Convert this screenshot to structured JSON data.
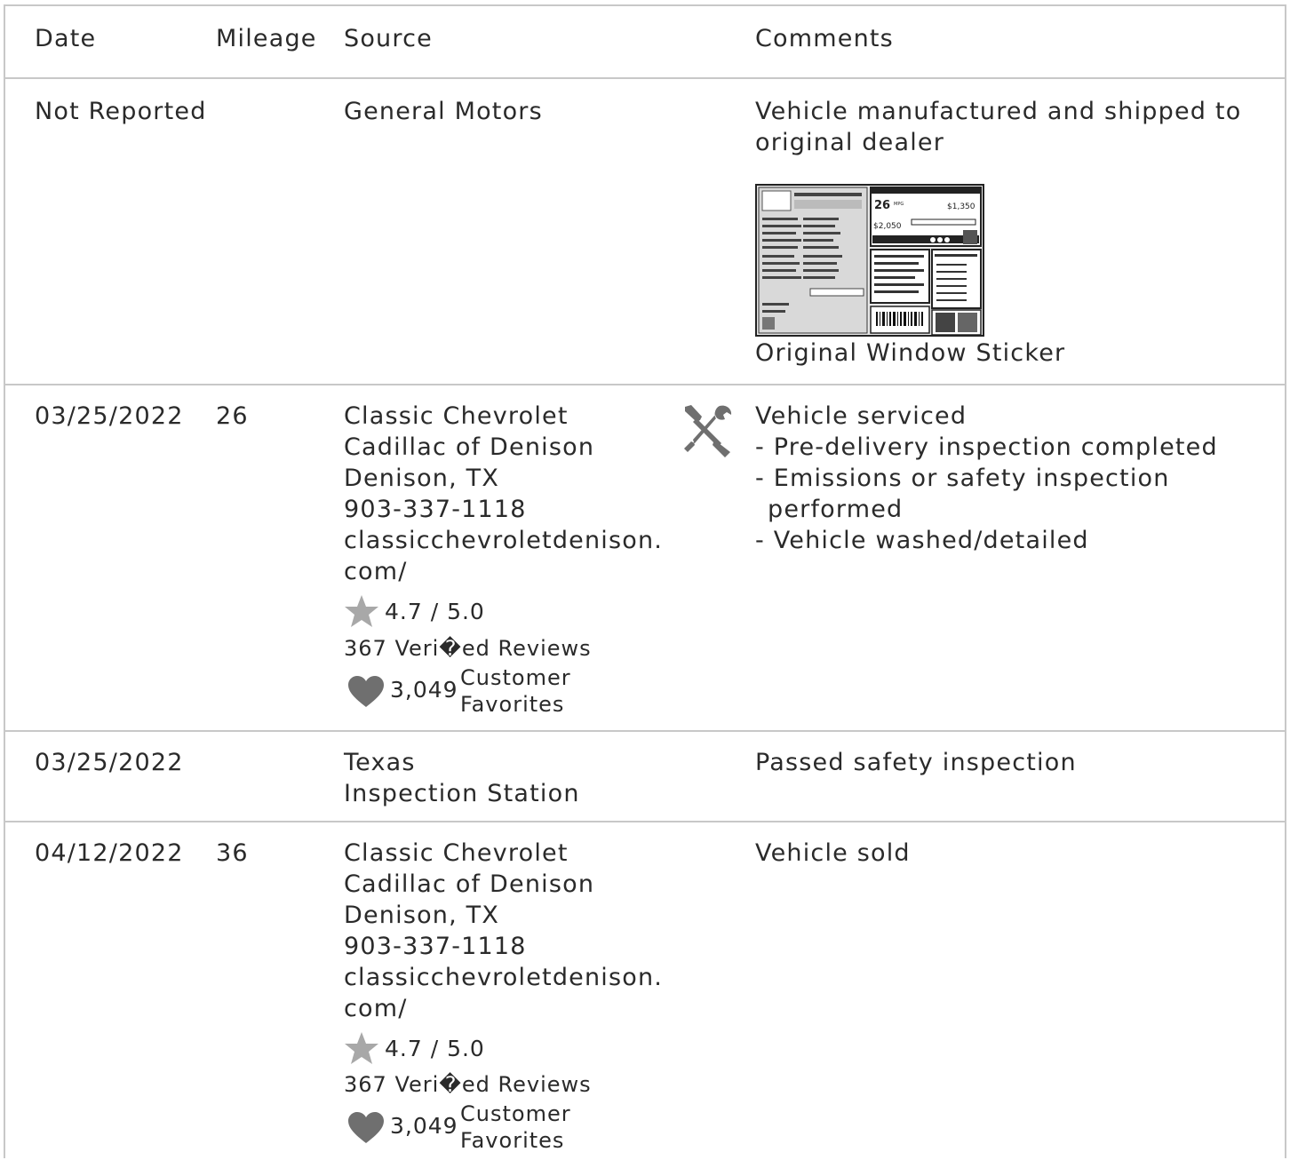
{
  "headers": {
    "date": "Date",
    "mileage": "Mileage",
    "source": "Source",
    "comments": "Comments"
  },
  "rows": [
    {
      "date": "Not Reported",
      "mileage": "",
      "source": [
        "General Motors"
      ],
      "comments": [
        "Vehicle manufactured and shipped to",
        "original dealer"
      ],
      "sticker_caption": "Original Window Sticker",
      "sticker_text": {
        "mpg": "26",
        "mpg_unit": "MPG",
        "cost1": "$1,350",
        "cost2": "$2,050"
      }
    },
    {
      "date": "03/25/2022",
      "mileage": "26",
      "source": [
        "Classic Chevrolet",
        "Cadillac of Denison",
        "Denison, TX",
        "903-337-1118",
        "classicchevroletdenison.",
        "com/"
      ],
      "rating": "4.7 / 5.0",
      "reviews": "367 Veri�ed Reviews",
      "favorites_count": "3,049",
      "favorites_label": [
        "Customer",
        "Favorites"
      ],
      "comments": [
        "Vehicle serviced",
        "- Pre-delivery inspection completed",
        "- Emissions or safety inspection",
        "performed",
        "- Vehicle washed/detailed"
      ],
      "icon": "service-tools-icon"
    },
    {
      "date": "03/25/2022",
      "mileage": "",
      "source": [
        "Texas",
        "Inspection Station"
      ],
      "comments": [
        "Passed safety inspection"
      ]
    },
    {
      "date": "04/12/2022",
      "mileage": "36",
      "source": [
        "Classic Chevrolet",
        "Cadillac of Denison",
        "Denison, TX",
        "903-337-1118",
        "classicchevroletdenison.",
        "com/"
      ],
      "rating": "4.7 / 5.0",
      "reviews": "367 Veri�ed Reviews",
      "favorites_count": "3,049",
      "favorites_label": [
        "Customer",
        "Favorites"
      ],
      "comments": [
        "Vehicle sold"
      ]
    }
  ],
  "colors": {
    "border": "#c8c8c8",
    "icon_gray": "#6f6f6f",
    "star_gray": "#a8a8a8"
  }
}
